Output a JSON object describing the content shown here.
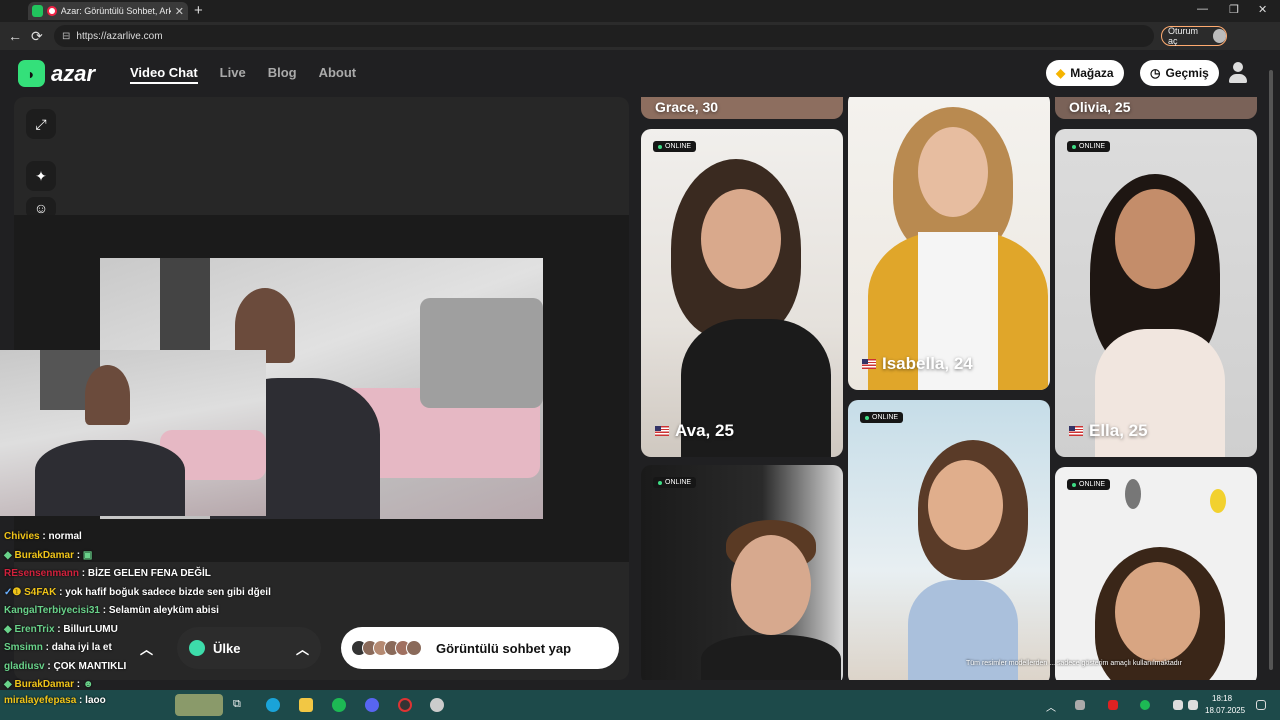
{
  "browser": {
    "tab_title": "Azar: Görüntülü Sohbet, Ark...",
    "url": "https://azarlive.com",
    "signin_label": "Oturum aç"
  },
  "header": {
    "logo": "azar",
    "nav": [
      "Video Chat",
      "Live",
      "Blog",
      "About"
    ],
    "shop_label": "Mağaza",
    "history_label": "Geçmiş"
  },
  "chat": [
    {
      "user": "Chivies",
      "text": "normal",
      "color": "#f0c419"
    },
    {
      "user": "BurakDamar",
      "text": "",
      "color": "#f0c419"
    },
    {
      "user": "REsensenmann",
      "text": "BİZE GELEN FENA DEĞİL",
      "color": "#d0213c"
    },
    {
      "user": "S4FAK",
      "text": "yok hafif boğuk sadece bizde sen gibi dğeil",
      "color": "#f0c419"
    },
    {
      "user": "KangalTerbiyecisi31",
      "text": "Selamün aleyküm abisi",
      "color": "#69d28a"
    },
    {
      "user": "ErenTrix",
      "text": "BillurLUMU",
      "color": "#69d28a"
    },
    {
      "user": "Smsimn",
      "text": "daha iyi la et",
      "color": "#69d28a"
    },
    {
      "user": "gladiusv",
      "text": "ÇOK MANTIKLI",
      "color": "#69d28a"
    },
    {
      "user": "BurakDamar",
      "text": "",
      "color": "#f0c419"
    }
  ],
  "overlay_chat": {
    "user": "miralayefepasa",
    "text": "laoo"
  },
  "controls": {
    "country_label": "Ülke",
    "cta_label": "Görüntülü sohbet yap"
  },
  "cards": {
    "online_label": "ONLINE",
    "ava": "Ava, 25",
    "isabella": "Isabella, 24",
    "ella": "Ella, 25",
    "top_left": "Grace, 30",
    "top_right": "Olivia, 25"
  },
  "disclaimer": "Tüm resimler modellerden ... sadece gösterim amaçlı kullanılmaktadır",
  "taskbar": {
    "time": "18:18",
    "date": "18.07.2025"
  }
}
